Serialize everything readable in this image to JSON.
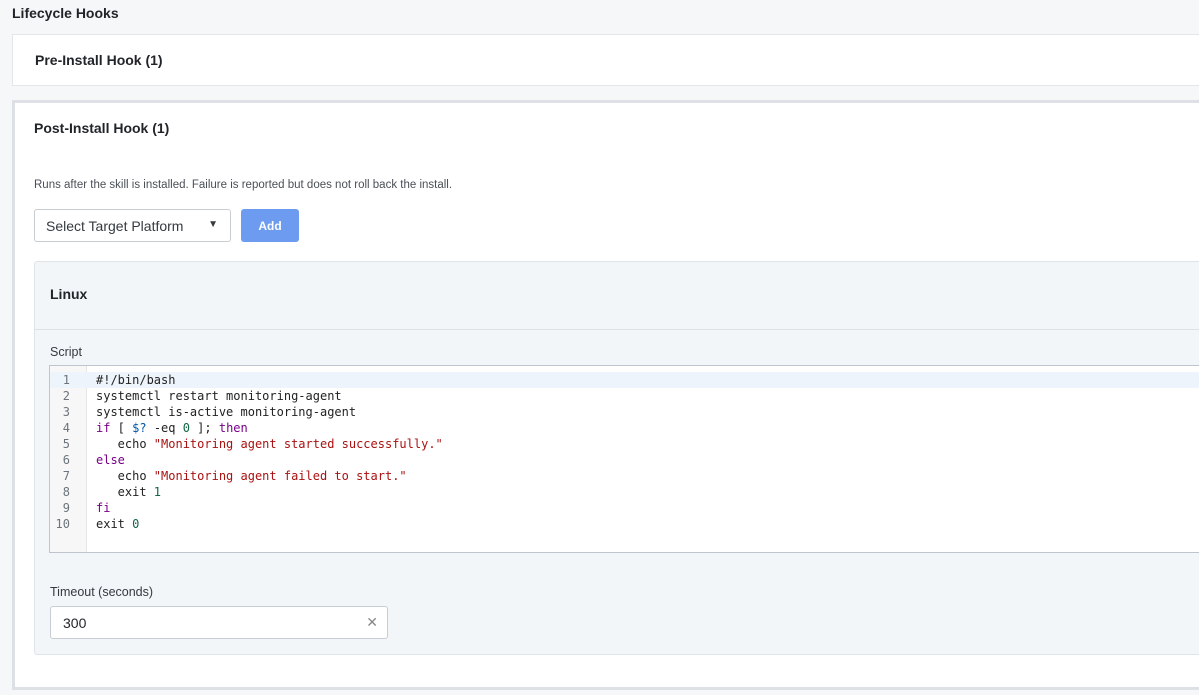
{
  "page_title": "Lifecycle Hooks",
  "pre_install": {
    "header": "Pre-Install Hook (1)"
  },
  "post_install": {
    "header": "Post-Install Hook (1)",
    "description": "Runs after the skill is installed. Failure is reported but does not roll back the install.",
    "platform_select": {
      "value": "Select Target Platform"
    },
    "add_label": "Add",
    "platform_card": {
      "title": "Linux",
      "script_label": "Script",
      "code_lines": [
        {
          "n": "1",
          "text": "#!/bin/bash"
        },
        {
          "n": "2",
          "text": "systemctl restart monitoring-agent"
        },
        {
          "n": "3",
          "text": "systemctl is-active monitoring-agent"
        },
        {
          "n": "4",
          "text": "if [ $? -eq 0 ]; then"
        },
        {
          "n": "5",
          "text": "   echo \"Monitoring agent started successfully.\""
        },
        {
          "n": "6",
          "text": "else"
        },
        {
          "n": "7",
          "text": "   echo \"Monitoring agent failed to start.\""
        },
        {
          "n": "8",
          "text": "   exit 1"
        },
        {
          "n": "9",
          "text": "fi"
        },
        {
          "n": "10",
          "text": "exit 0"
        }
      ],
      "timeout_label": "Timeout (seconds)",
      "timeout_value": "300"
    }
  },
  "icons": {
    "caret": "caret-down-icon",
    "clear": "clear-x-icon"
  },
  "colors": {
    "accent": "#6c9bef",
    "keyword": "#770088",
    "string": "#aa1111",
    "number": "#116644",
    "variable": "#0055aa"
  }
}
